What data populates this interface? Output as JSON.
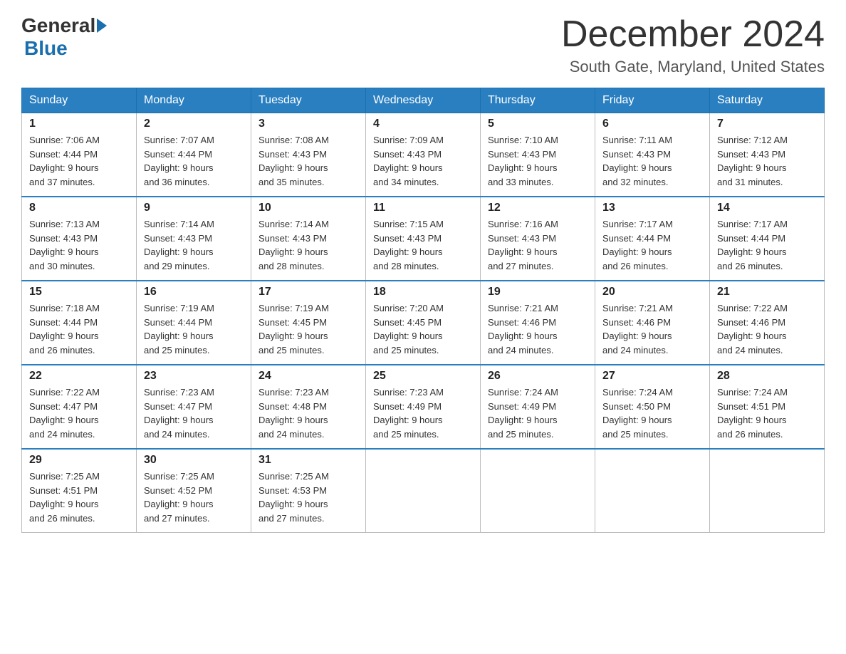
{
  "header": {
    "logo_general": "General",
    "logo_blue": "Blue",
    "month_title": "December 2024",
    "location": "South Gate, Maryland, United States"
  },
  "days_of_week": [
    "Sunday",
    "Monday",
    "Tuesday",
    "Wednesday",
    "Thursday",
    "Friday",
    "Saturday"
  ],
  "weeks": [
    [
      {
        "day": "1",
        "sunrise": "7:06 AM",
        "sunset": "4:44 PM",
        "daylight": "9 hours and 37 minutes."
      },
      {
        "day": "2",
        "sunrise": "7:07 AM",
        "sunset": "4:44 PM",
        "daylight": "9 hours and 36 minutes."
      },
      {
        "day": "3",
        "sunrise": "7:08 AM",
        "sunset": "4:43 PM",
        "daylight": "9 hours and 35 minutes."
      },
      {
        "day": "4",
        "sunrise": "7:09 AM",
        "sunset": "4:43 PM",
        "daylight": "9 hours and 34 minutes."
      },
      {
        "day": "5",
        "sunrise": "7:10 AM",
        "sunset": "4:43 PM",
        "daylight": "9 hours and 33 minutes."
      },
      {
        "day": "6",
        "sunrise": "7:11 AM",
        "sunset": "4:43 PM",
        "daylight": "9 hours and 32 minutes."
      },
      {
        "day": "7",
        "sunrise": "7:12 AM",
        "sunset": "4:43 PM",
        "daylight": "9 hours and 31 minutes."
      }
    ],
    [
      {
        "day": "8",
        "sunrise": "7:13 AM",
        "sunset": "4:43 PM",
        "daylight": "9 hours and 30 minutes."
      },
      {
        "day": "9",
        "sunrise": "7:14 AM",
        "sunset": "4:43 PM",
        "daylight": "9 hours and 29 minutes."
      },
      {
        "day": "10",
        "sunrise": "7:14 AM",
        "sunset": "4:43 PM",
        "daylight": "9 hours and 28 minutes."
      },
      {
        "day": "11",
        "sunrise": "7:15 AM",
        "sunset": "4:43 PM",
        "daylight": "9 hours and 28 minutes."
      },
      {
        "day": "12",
        "sunrise": "7:16 AM",
        "sunset": "4:43 PM",
        "daylight": "9 hours and 27 minutes."
      },
      {
        "day": "13",
        "sunrise": "7:17 AM",
        "sunset": "4:44 PM",
        "daylight": "9 hours and 26 minutes."
      },
      {
        "day": "14",
        "sunrise": "7:17 AM",
        "sunset": "4:44 PM",
        "daylight": "9 hours and 26 minutes."
      }
    ],
    [
      {
        "day": "15",
        "sunrise": "7:18 AM",
        "sunset": "4:44 PM",
        "daylight": "9 hours and 26 minutes."
      },
      {
        "day": "16",
        "sunrise": "7:19 AM",
        "sunset": "4:44 PM",
        "daylight": "9 hours and 25 minutes."
      },
      {
        "day": "17",
        "sunrise": "7:19 AM",
        "sunset": "4:45 PM",
        "daylight": "9 hours and 25 minutes."
      },
      {
        "day": "18",
        "sunrise": "7:20 AM",
        "sunset": "4:45 PM",
        "daylight": "9 hours and 25 minutes."
      },
      {
        "day": "19",
        "sunrise": "7:21 AM",
        "sunset": "4:46 PM",
        "daylight": "9 hours and 24 minutes."
      },
      {
        "day": "20",
        "sunrise": "7:21 AM",
        "sunset": "4:46 PM",
        "daylight": "9 hours and 24 minutes."
      },
      {
        "day": "21",
        "sunrise": "7:22 AM",
        "sunset": "4:46 PM",
        "daylight": "9 hours and 24 minutes."
      }
    ],
    [
      {
        "day": "22",
        "sunrise": "7:22 AM",
        "sunset": "4:47 PM",
        "daylight": "9 hours and 24 minutes."
      },
      {
        "day": "23",
        "sunrise": "7:23 AM",
        "sunset": "4:47 PM",
        "daylight": "9 hours and 24 minutes."
      },
      {
        "day": "24",
        "sunrise": "7:23 AM",
        "sunset": "4:48 PM",
        "daylight": "9 hours and 24 minutes."
      },
      {
        "day": "25",
        "sunrise": "7:23 AM",
        "sunset": "4:49 PM",
        "daylight": "9 hours and 25 minutes."
      },
      {
        "day": "26",
        "sunrise": "7:24 AM",
        "sunset": "4:49 PM",
        "daylight": "9 hours and 25 minutes."
      },
      {
        "day": "27",
        "sunrise": "7:24 AM",
        "sunset": "4:50 PM",
        "daylight": "9 hours and 25 minutes."
      },
      {
        "day": "28",
        "sunrise": "7:24 AM",
        "sunset": "4:51 PM",
        "daylight": "9 hours and 26 minutes."
      }
    ],
    [
      {
        "day": "29",
        "sunrise": "7:25 AM",
        "sunset": "4:51 PM",
        "daylight": "9 hours and 26 minutes."
      },
      {
        "day": "30",
        "sunrise": "7:25 AM",
        "sunset": "4:52 PM",
        "daylight": "9 hours and 27 minutes."
      },
      {
        "day": "31",
        "sunrise": "7:25 AM",
        "sunset": "4:53 PM",
        "daylight": "9 hours and 27 minutes."
      },
      null,
      null,
      null,
      null
    ]
  ],
  "labels": {
    "sunrise": "Sunrise:",
    "sunset": "Sunset:",
    "daylight": "Daylight:"
  }
}
